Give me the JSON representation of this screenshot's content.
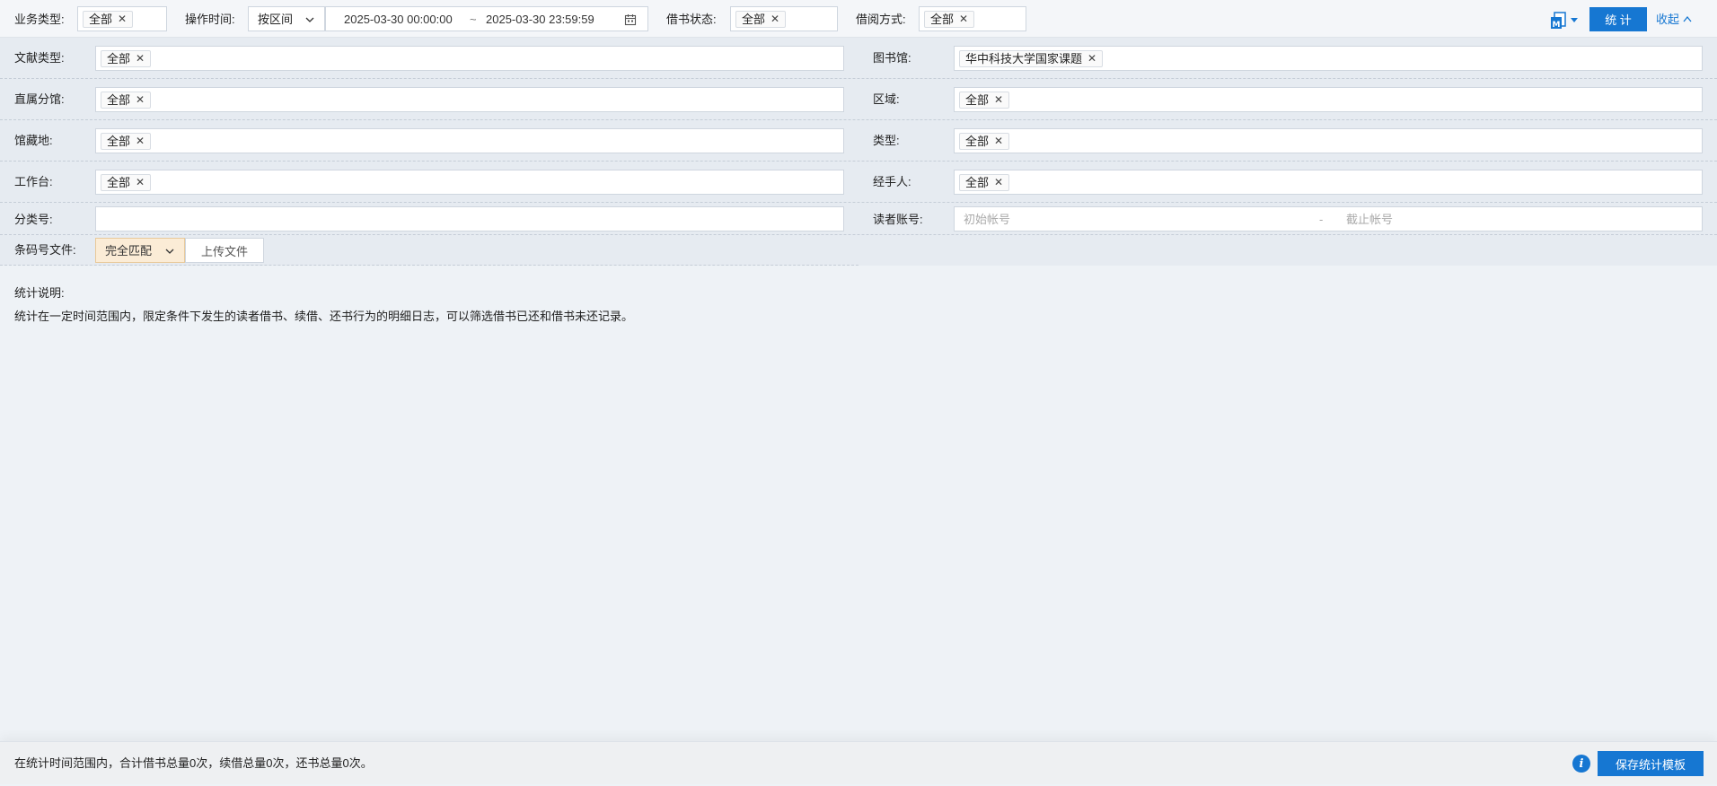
{
  "top": {
    "business_type": {
      "label": "业务类型:",
      "tags": [
        "全部"
      ]
    },
    "op_time": {
      "label": "操作时间:",
      "mode": "按区间",
      "start": "2025-03-30 00:00:00",
      "sep": "~",
      "end": "2025-03-30 23:59:59"
    },
    "borrow_status": {
      "label": "借书状态:",
      "tags": [
        "全部"
      ]
    },
    "borrow_method": {
      "label": "借阅方式:",
      "tags": [
        "全部"
      ]
    },
    "template_icon": "document-template-icon",
    "stat_button": "统 计",
    "collapse_link": "收起"
  },
  "filters": {
    "doc_type": {
      "label": "文献类型:",
      "tags": [
        "全部"
      ]
    },
    "library": {
      "label": "图书馆:",
      "tags": [
        "华中科技大学国家课题"
      ]
    },
    "branch": {
      "label": "直属分馆:",
      "tags": [
        "全部"
      ]
    },
    "region": {
      "label": "区域:",
      "tags": [
        "全部"
      ]
    },
    "location": {
      "label": "馆藏地:",
      "tags": [
        "全部"
      ]
    },
    "type": {
      "label": "类型:",
      "tags": [
        "全部"
      ]
    },
    "workstation": {
      "label": "工作台:",
      "tags": [
        "全部"
      ]
    },
    "operator": {
      "label": "经手人:",
      "tags": [
        "全部"
      ]
    },
    "class_no": {
      "label": "分类号:",
      "value": ""
    },
    "reader_account": {
      "label": "读者账号:",
      "start_placeholder": "初始帐号",
      "sep": "-",
      "end_placeholder": "截止帐号"
    },
    "barcode_file": {
      "label": "条码号文件:",
      "match_mode": "完全匹配",
      "upload_label": "上传文件"
    }
  },
  "description": {
    "title": "统计说明:",
    "text": "统计在一定时间范围内，限定条件下发生的读者借书、续借、还书行为的明细日志，可以筛选借书已还和借书未还记录。"
  },
  "footer": {
    "summary": "在统计时间范围内，合计借书总量0次，续借总量0次，还书总量0次。",
    "save_button": "保存统计模板"
  },
  "colors": {
    "accent": "#1677d2",
    "match_bg": "#fbecd6",
    "filter_bg": "#e6ebf1"
  }
}
